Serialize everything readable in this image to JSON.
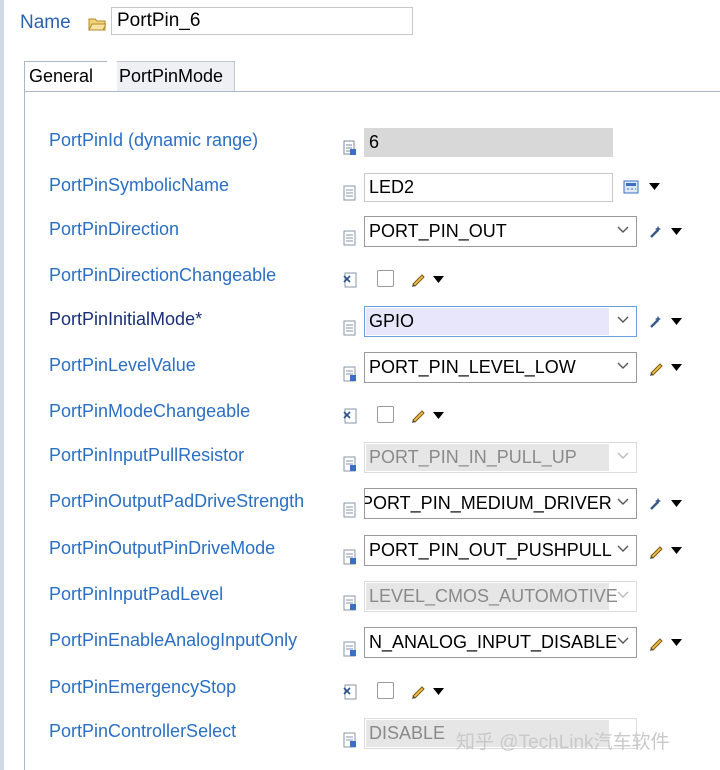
{
  "header": {
    "name_label": "Name",
    "name_value": "PortPin_6"
  },
  "tabs": [
    {
      "label": "General",
      "active": true
    },
    {
      "label": "PortPinMode",
      "active": false
    }
  ],
  "fields": {
    "id": {
      "label": "PortPinId (dynamic range)",
      "value": "6"
    },
    "sym": {
      "label": "PortPinSymbolicName",
      "value": "LED2"
    },
    "dir": {
      "label": "PortPinDirection",
      "value": "PORT_PIN_OUT"
    },
    "dirch": {
      "label": "PortPinDirectionChangeable",
      "checked": false
    },
    "init": {
      "label": "PortPinInitialMode*",
      "value": "GPIO"
    },
    "level": {
      "label": "PortPinLevelValue",
      "value": "PORT_PIN_LEVEL_LOW"
    },
    "modech": {
      "label": "PortPinModeChangeable",
      "checked": false
    },
    "pull": {
      "label": "PortPinInputPullResistor",
      "value": "PORT_PIN_IN_PULL_UP"
    },
    "drvstr": {
      "label": "PortPinOutputPadDriveStrength",
      "value": "PORT_PIN_MEDIUM_DRIVER"
    },
    "drvmode": {
      "label": "PortPinOutputPinDriveMode",
      "value": "PORT_PIN_OUT_PUSHPULL"
    },
    "padlvl": {
      "label": "PortPinInputPadLevel",
      "value": "LEVEL_CMOS_AUTOMOTIVE"
    },
    "analog": {
      "label": "PortPinEnableAnalogInputOnly",
      "value": "N_ANALOG_INPUT_DISABLE"
    },
    "estop": {
      "label": "PortPinEmergencyStop",
      "checked": false
    },
    "ctrl": {
      "label": "PortPinControllerSelect",
      "value": "DISABLE"
    }
  },
  "watermark": "知乎 @TechLink汽车软件",
  "colors": {
    "label": "#2a6fc4",
    "required_label": "#1a2f78",
    "readonly_bg": "#d8d8d8",
    "selected_bg": "#e8e6fb"
  }
}
